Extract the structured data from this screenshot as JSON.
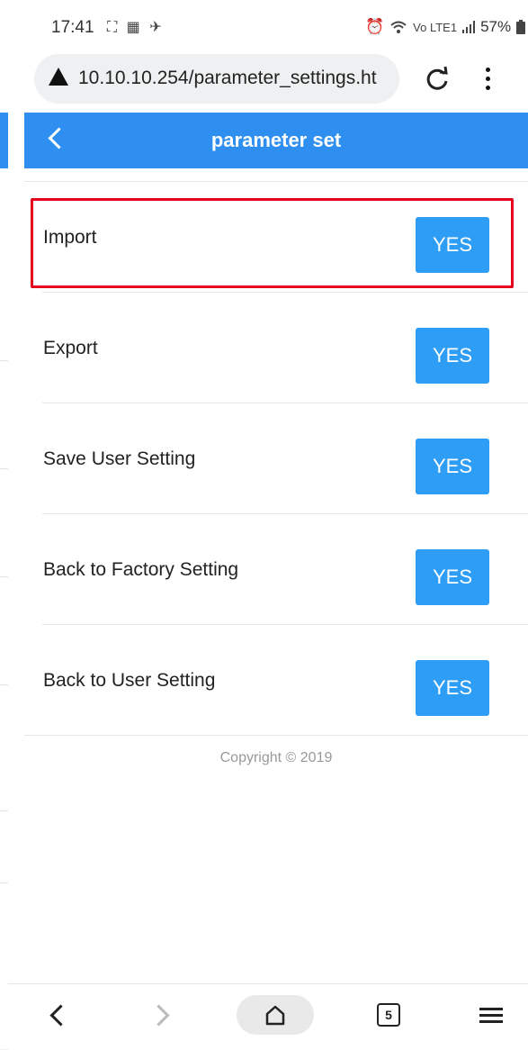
{
  "status_bar": {
    "time": "17:41",
    "left_icons": "⛶ ▦ ✈",
    "signal_text": "Vo LTE1",
    "battery": "57%"
  },
  "browser": {
    "url": "10.10.10.254/parameter_settings.ht",
    "tab_count": "5"
  },
  "header": {
    "title": "parameter set"
  },
  "rows": [
    {
      "label": "Import",
      "button": "YES"
    },
    {
      "label": "Export",
      "button": "YES"
    },
    {
      "label": "Save User Setting",
      "button": "YES"
    },
    {
      "label": "Back to Factory Setting",
      "button": "YES"
    },
    {
      "label": "Back to User Setting",
      "button": "YES"
    }
  ],
  "footer": {
    "copyright": "Copyright © 2019"
  },
  "colors": {
    "accent": "#2e8ff0",
    "button": "#2e9df5",
    "highlight": "#e3001b"
  }
}
